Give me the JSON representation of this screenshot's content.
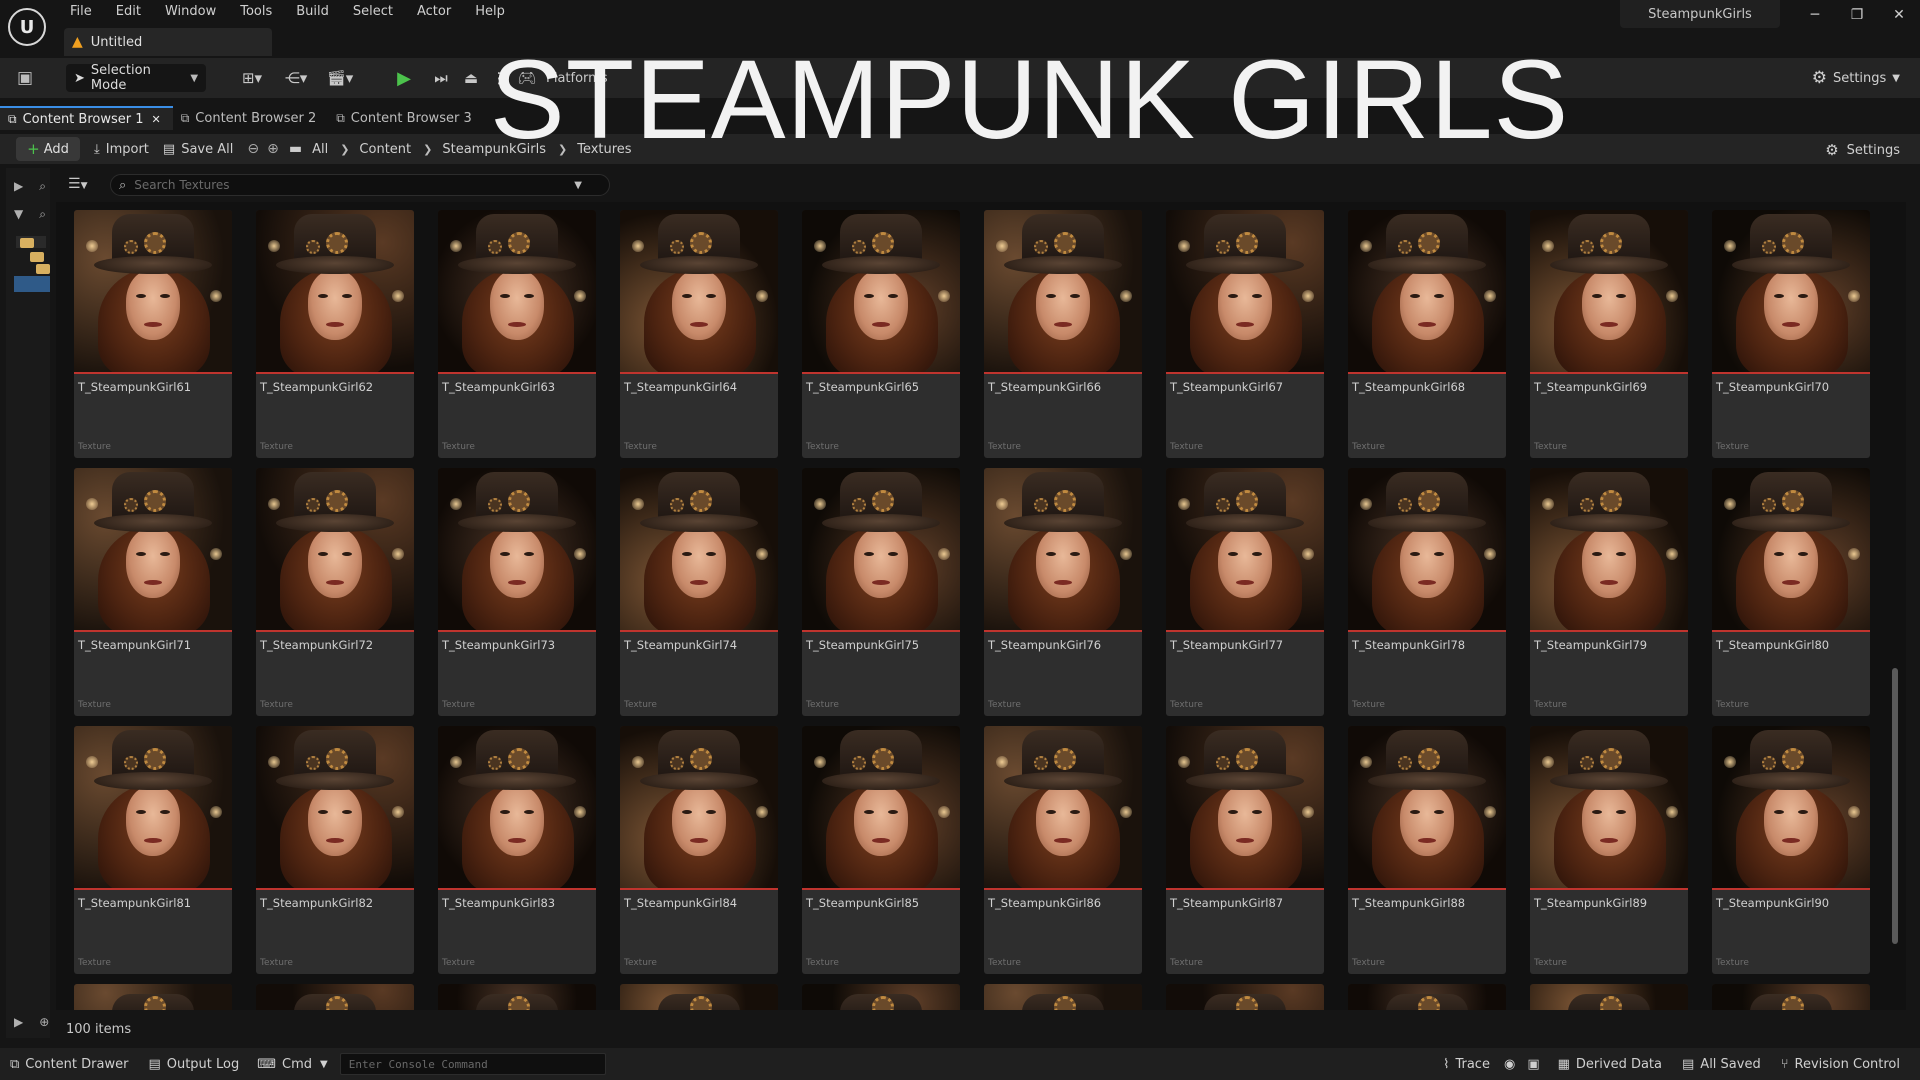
{
  "menu": [
    "File",
    "Edit",
    "Window",
    "Tools",
    "Build",
    "Select",
    "Actor",
    "Help"
  ],
  "document_tab": "Untitled",
  "project_name": "SteampunkGirls",
  "toolbar": {
    "mode": "Selection Mode",
    "platforms": "Platforms",
    "settings": "Settings"
  },
  "overlay_title": "STEAMPUNK GIRLS",
  "cb_tabs": [
    {
      "label": "Content Browser 1",
      "active": true
    },
    {
      "label": "Content Browser 2",
      "active": false
    },
    {
      "label": "Content Browser 3",
      "active": false
    }
  ],
  "pathbar": {
    "add": "Add",
    "import": "Import",
    "save_all": "Save All",
    "crumbs": [
      "All",
      "Content",
      "SteampunkGirls",
      "Textures"
    ],
    "settings": "Settings"
  },
  "search": {
    "placeholder": "Search Textures"
  },
  "assets": [
    {
      "name": "T_SteampunkGirl61",
      "type": "Texture"
    },
    {
      "name": "T_SteampunkGirl62",
      "type": "Texture"
    },
    {
      "name": "T_SteampunkGirl63",
      "type": "Texture"
    },
    {
      "name": "T_SteampunkGirl64",
      "type": "Texture"
    },
    {
      "name": "T_SteampunkGirl65",
      "type": "Texture"
    },
    {
      "name": "T_SteampunkGirl66",
      "type": "Texture"
    },
    {
      "name": "T_SteampunkGirl67",
      "type": "Texture"
    },
    {
      "name": "T_SteampunkGirl68",
      "type": "Texture"
    },
    {
      "name": "T_SteampunkGirl69",
      "type": "Texture"
    },
    {
      "name": "T_SteampunkGirl70",
      "type": "Texture"
    },
    {
      "name": "T_SteampunkGirl71",
      "type": "Texture"
    },
    {
      "name": "T_SteampunkGirl72",
      "type": "Texture"
    },
    {
      "name": "T_SteampunkGirl73",
      "type": "Texture"
    },
    {
      "name": "T_SteampunkGirl74",
      "type": "Texture"
    },
    {
      "name": "T_SteampunkGirl75",
      "type": "Texture"
    },
    {
      "name": "T_SteampunkGirl76",
      "type": "Texture"
    },
    {
      "name": "T_SteampunkGirl77",
      "type": "Texture"
    },
    {
      "name": "T_SteampunkGirl78",
      "type": "Texture"
    },
    {
      "name": "T_SteampunkGirl79",
      "type": "Texture"
    },
    {
      "name": "T_SteampunkGirl80",
      "type": "Texture"
    },
    {
      "name": "T_SteampunkGirl81",
      "type": "Texture"
    },
    {
      "name": "T_SteampunkGirl82",
      "type": "Texture"
    },
    {
      "name": "T_SteampunkGirl83",
      "type": "Texture"
    },
    {
      "name": "T_SteampunkGirl84",
      "type": "Texture"
    },
    {
      "name": "T_SteampunkGirl85",
      "type": "Texture"
    },
    {
      "name": "T_SteampunkGirl86",
      "type": "Texture"
    },
    {
      "name": "T_SteampunkGirl87",
      "type": "Texture"
    },
    {
      "name": "T_SteampunkGirl88",
      "type": "Texture"
    },
    {
      "name": "T_SteampunkGirl89",
      "type": "Texture"
    },
    {
      "name": "T_SteampunkGirl90",
      "type": "Texture"
    }
  ],
  "partial_row_count": 10,
  "item_count": "100 items",
  "statusbar": {
    "content_drawer": "Content Drawer",
    "output_log": "Output Log",
    "cmd": "Cmd",
    "console_placeholder": "Enter Console Command",
    "trace": "Trace",
    "derived_data": "Derived Data",
    "all_saved": "All Saved",
    "revision_control": "Revision Control"
  },
  "colors": {
    "accent_blue": "#3a8ee6",
    "texture_underline": "#c0342e",
    "play_green": "#4cc24c"
  }
}
